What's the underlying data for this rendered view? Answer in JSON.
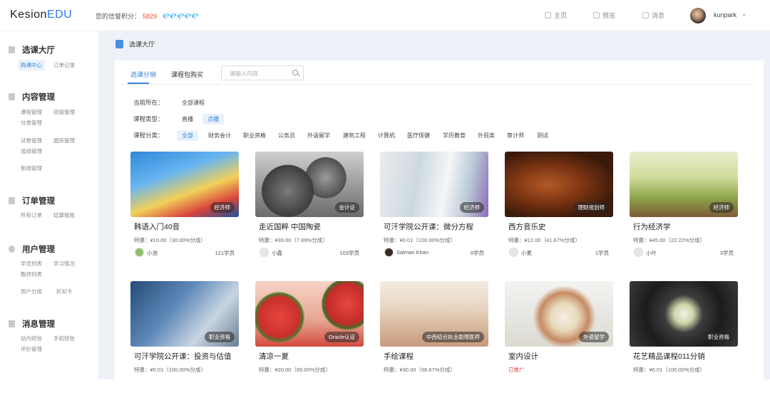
{
  "header": {
    "logo_main": "Kesion",
    "logo_accent": "EDU",
    "credit_label": "您的信誉积分：",
    "credit_value": "5829",
    "credit_gems": "💎💎💎💎💎",
    "nav": [
      {
        "label": "主页",
        "icon": "home-icon"
      },
      {
        "label": "预览",
        "icon": "monitor-icon"
      },
      {
        "label": "消息",
        "icon": "bell-icon"
      }
    ],
    "username": "kunpark",
    "dropdown_icon": "chevron-down-icon"
  },
  "sidebar": {
    "sections": [
      {
        "title": "选课大厅",
        "icon": "book-icon",
        "links": [
          "购课中心",
          "订单记录"
        ]
      },
      {
        "title": "内容管理",
        "icon": "document-icon",
        "links": [
          "课程管理",
          "班级管理",
          "分类管理",
          "试卷管理",
          "题库管理",
          "成绩管理",
          "新闻管理"
        ]
      },
      {
        "title": "订单管理",
        "icon": "list-icon",
        "links": [
          "所有订单",
          "结算报账"
        ]
      },
      {
        "title": "用户管理",
        "icon": "user-icon",
        "links": [
          "学员列表",
          "学习情况",
          "教师列表",
          "用户分组",
          "折扣卡"
        ]
      },
      {
        "title": "消息管理",
        "icon": "message-icon",
        "links": [
          "站内短信",
          "手机短信",
          "评价管理"
        ]
      }
    ]
  },
  "breadcrumb": {
    "icon": "book-icon",
    "text": "选课大厅"
  },
  "tabs": [
    "选课分销",
    "课程包购买"
  ],
  "search": {
    "placeholder": "请输入内容"
  },
  "filters": {
    "location_label": "当前所在：",
    "location_value": "全部课程",
    "type_label": "课程类型：",
    "types": [
      "直播",
      "点播"
    ],
    "category_label": "课程分类：",
    "categories": [
      "全部",
      "财务会计",
      "职业资格",
      "公务员",
      "外语留学",
      "建筑工程",
      "计算机",
      "医疗保健",
      "学历教育",
      "外贸类",
      "审计师",
      "测试"
    ]
  },
  "courses": [
    {
      "title": "韩语入门40音",
      "price": "特惠：¥10.00（30.00%分成）",
      "teacher": "小池",
      "students": "121学员",
      "badge": "经济师"
    },
    {
      "title": "走近国粹 中国陶瓷",
      "price": "特惠：¥39.00（7.69%分成）",
      "teacher": "小鑫",
      "students": "103学员",
      "badge": "会计证"
    },
    {
      "title": "可汗学院公开课：微分方程",
      "price": "特惠：¥0.01（100.00%分成）",
      "teacher": "Salman Khan",
      "students": "0学员",
      "badge": "经济师"
    },
    {
      "title": "西方音乐史",
      "price": "特惠：¥12.00（41.67%分成）",
      "teacher": "小麦",
      "students": "1学员",
      "badge": "理财规划师"
    },
    {
      "title": "行为经济学",
      "price": "特惠：¥45.00（22.22%分成）",
      "teacher": "小叶",
      "students": "3学员",
      "badge": "经济师"
    },
    {
      "title": "可汗学院公开课：投资与估值",
      "price": "特惠：¥0.01（100.00%分成）",
      "teacher": "",
      "students": "",
      "badge": "职业资格"
    },
    {
      "title": "清凉一夏",
      "price": "特惠：¥20.00（65.00%分成）",
      "teacher": "",
      "students": "",
      "badge": "Oracle认证"
    },
    {
      "title": "手绘课程",
      "price": "特惠：¥30.00（66.67%分成）",
      "teacher": "",
      "students": "",
      "badge": "中西结合执业助理医师"
    },
    {
      "title": "室内设计",
      "price": "已推广",
      "teacher": "",
      "students": "",
      "badge": "外语留学"
    },
    {
      "title": "花艺精品课程011分销",
      "price": "特惠：¥0.01（100.00%分成）",
      "teacher": "",
      "students": "",
      "badge": "职业资格"
    }
  ]
}
